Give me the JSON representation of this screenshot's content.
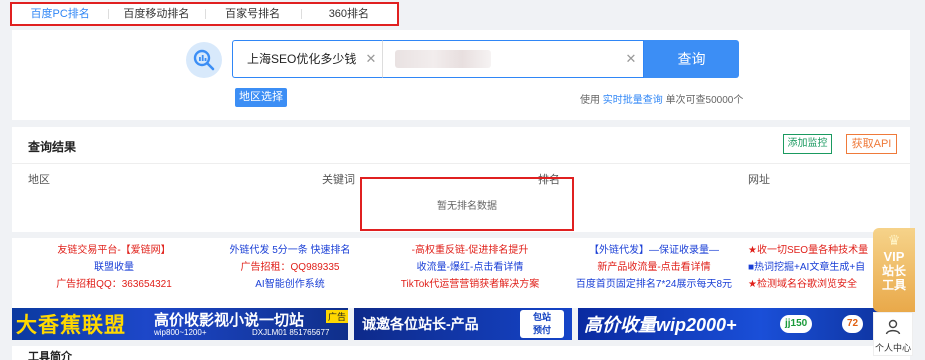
{
  "top_tabs": [
    "百度PC排名",
    "百度移动排名",
    "百家号排名",
    "360排名"
  ],
  "search": {
    "keyword_value": "上海SEO优化多少钱",
    "query_label": "查询",
    "region_label": "地区选择",
    "batch_tip": {
      "prefix": "使用",
      "link": "实时批量查询",
      "suffix": "单次可查50000个"
    }
  },
  "results": {
    "title": "查询结果",
    "add_monitor_label": "添加监控",
    "get_api_label": "获取API",
    "columns": [
      "地区",
      "关键词",
      "排名",
      "网址"
    ],
    "empty_text": "暂无排名数据"
  },
  "ads": [
    {
      "lines": [
        "友链交易平台-【爱链网】",
        "联盟收量",
        "广告招租QQ：363654321"
      ]
    },
    {
      "lines": [
        "外链代发 5分一条 快速排名",
        "广告招租：QQ989335",
        "AI智能创作系统"
      ]
    },
    {
      "lines": [
        "-高权重反链-促进排名提升",
        "收流量-爆红-点击看详情",
        "TikTok代运营营销获者解决方案"
      ]
    },
    {
      "lines": [
        "【外链代发】—保证收录量—",
        "新产品收流量-点击看详情",
        "百度首页固定排名7*24展示每天8元"
      ]
    },
    {
      "lines": [
        "★收一切SEO量各种技术量",
        "■热词挖掘+AI文章生成+自",
        "★检测域名谷歌浏览安全"
      ]
    }
  ],
  "banners": {
    "b1": {
      "title": "大香蕉联盟",
      "slogan": "高价收影视小说一切站",
      "tag": "广告",
      "sub1": "wip800~1200+",
      "sub2": "DXJLM01 851765677"
    },
    "b2": {
      "title": "诚邀各位站长-产品",
      "badge_top": "包站",
      "badge_bottom": "预付"
    },
    "b3": {
      "title": "高价收量wip2000+",
      "chip1": "jj150",
      "chip2": "72"
    }
  },
  "bottom": {
    "title": "工具简介"
  },
  "vip": {
    "line1": "VIP",
    "line2": "站长",
    "line3": "工具"
  },
  "user_center_label": "个人中心",
  "colors": {
    "primary": "#3c8ef5",
    "highlight_border": "#e02020",
    "monitor": "#1a9a60",
    "api": "#ef7a3a"
  }
}
